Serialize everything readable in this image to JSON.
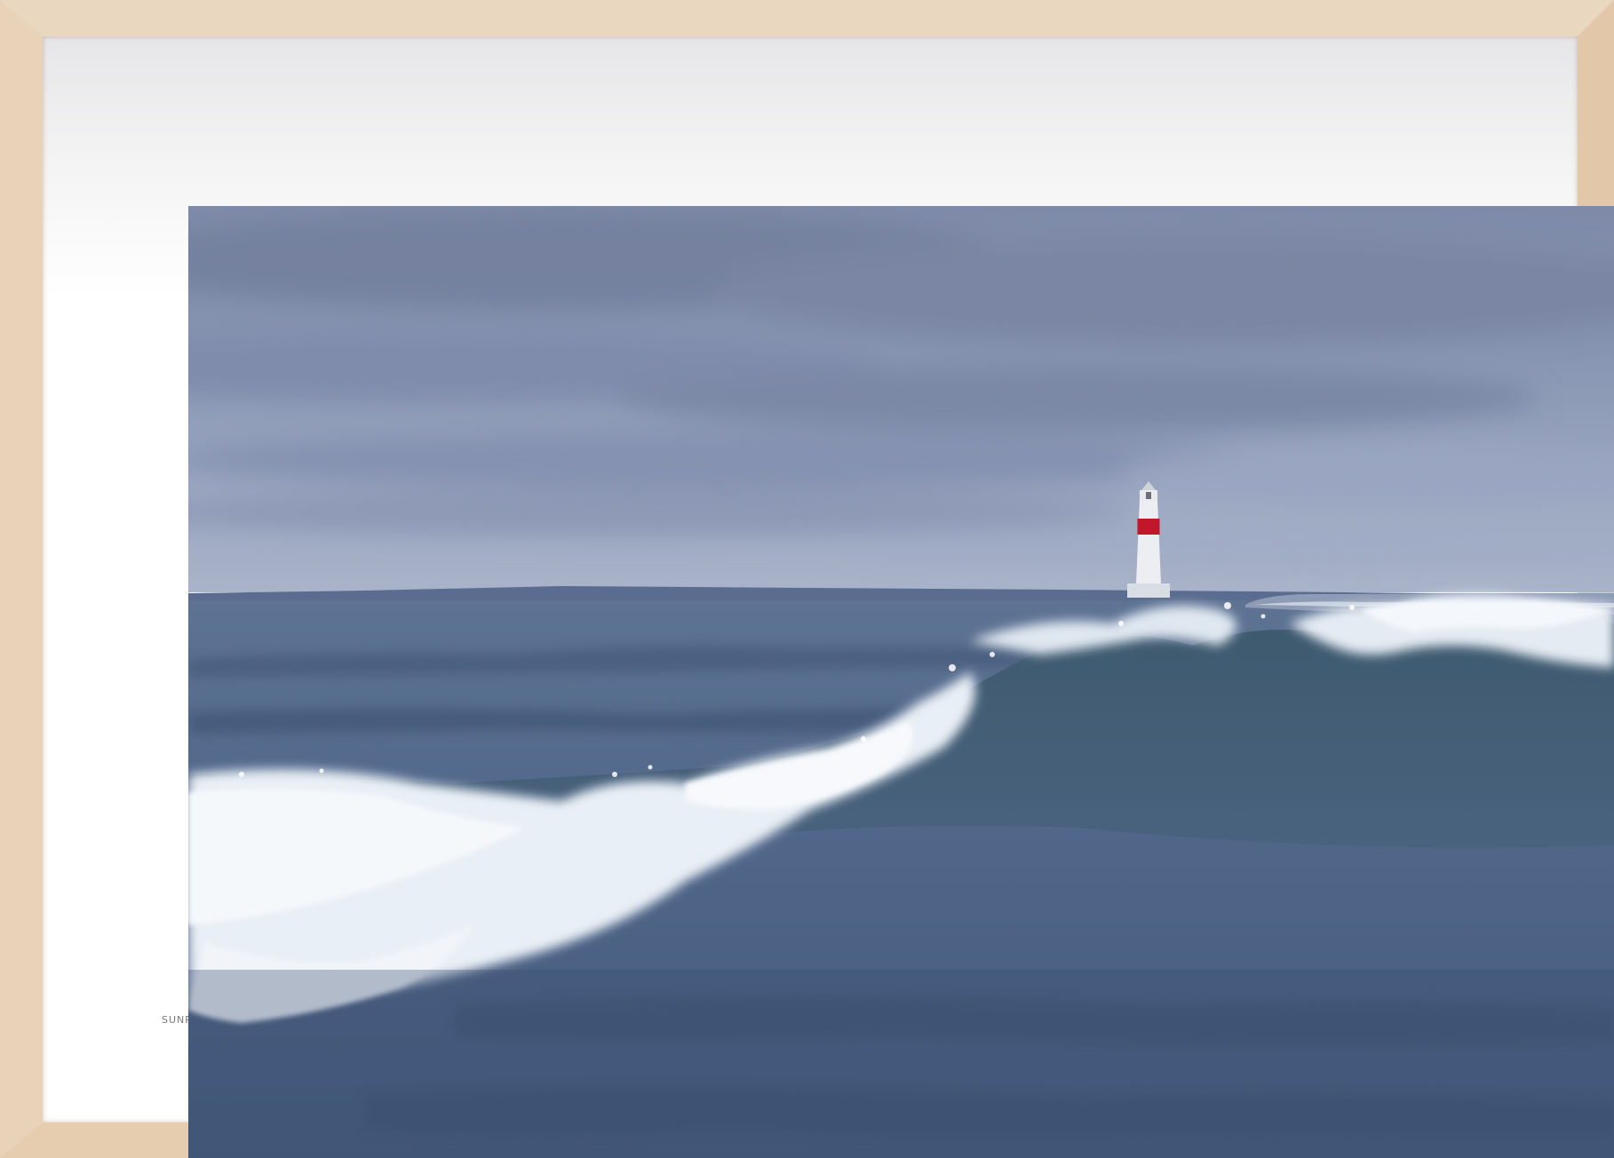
{
  "print": {
    "caption": "SUNR"
  },
  "scene": {
    "subject": "lighthouse",
    "colors": {
      "frame_wood": "#e8d3b9",
      "sky": "#8e9ab4",
      "water": "#4f6584",
      "foam": "#f2f6fa",
      "lighthouse_band": "#c0172b"
    }
  }
}
